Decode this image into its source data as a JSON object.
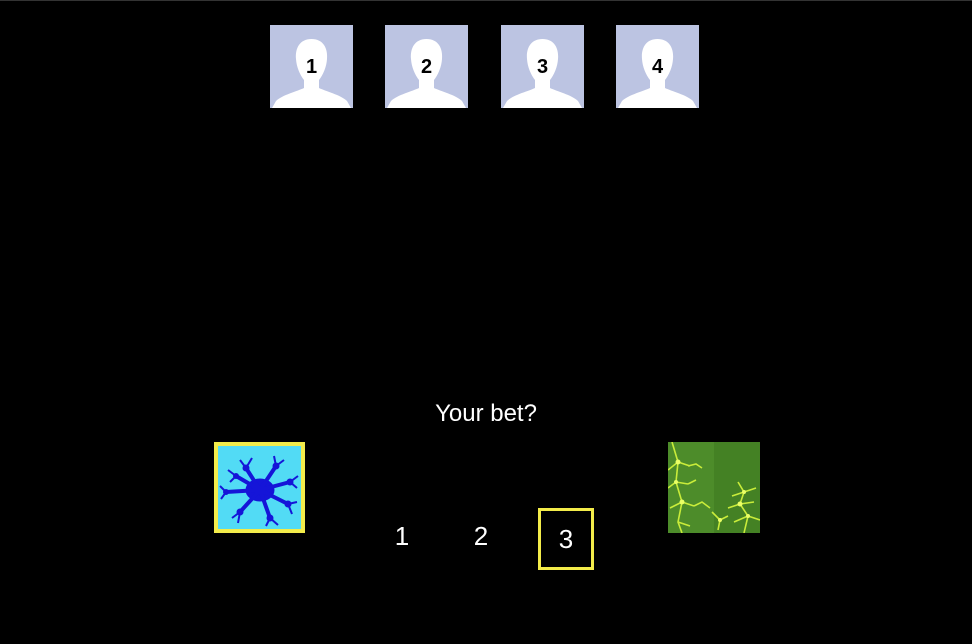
{
  "players": [
    {
      "label": "1",
      "icon": "person-silhouette-icon"
    },
    {
      "label": "2",
      "icon": "person-silhouette-icon"
    },
    {
      "label": "3",
      "icon": "person-silhouette-icon"
    },
    {
      "label": "4",
      "icon": "person-silhouette-icon"
    }
  ],
  "prompt": "Your bet?",
  "cards": {
    "left": {
      "icon": "blue-fractal-card",
      "selected": true,
      "colors": {
        "bg": "#52dbf5",
        "fractal": "#1515d8",
        "border": "#f3ec4a"
      }
    },
    "right": {
      "icon": "green-fractal-card",
      "selected": false,
      "colors": {
        "bg": "#4d8c2a",
        "fractal": "#c9ec3a"
      }
    }
  },
  "bet_options": [
    {
      "label": "1",
      "selected": false
    },
    {
      "label": "2",
      "selected": false
    },
    {
      "label": "3",
      "selected": true
    }
  ],
  "colors": {
    "background": "#000000",
    "highlight": "#f3ec4a",
    "avatar_bg": "#bcc4e2",
    "text": "#ffffff"
  }
}
